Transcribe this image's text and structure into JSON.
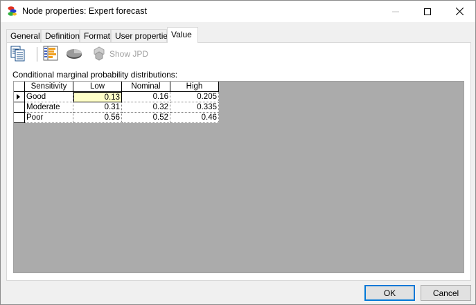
{
  "window": {
    "title": "Node properties: Expert forecast"
  },
  "tabs": [
    {
      "label": "General"
    },
    {
      "label": "Definition"
    },
    {
      "label": "Format"
    },
    {
      "label": "User properties"
    },
    {
      "label": "Value"
    }
  ],
  "active_tab": "Value",
  "toolbar": {
    "show_jpd_label": "Show JPD"
  },
  "caption": "Conditional marginal probability distributions:",
  "table": {
    "corner_header": "Sensitivity",
    "columns": [
      "Low",
      "Nominal",
      "High"
    ],
    "rows": [
      {
        "label": "Good",
        "values": [
          "0.13",
          "0.16",
          "0.205"
        ]
      },
      {
        "label": "Moderate",
        "values": [
          "0.31",
          "0.32",
          "0.335"
        ]
      },
      {
        "label": "Poor",
        "values": [
          "0.56",
          "0.52",
          "0.46"
        ]
      }
    ]
  },
  "buttons": {
    "ok": "OK",
    "cancel": "Cancel"
  },
  "colors": {
    "selected_cell": "#ffffc8",
    "ok_border": "#0078d7",
    "grid_background": "#ababab"
  },
  "icons": [
    "app-node-icon",
    "copy-icon",
    "bar-chart-icon",
    "pie-chart-icon",
    "jpd-icon",
    "row-pointer-icon"
  ]
}
